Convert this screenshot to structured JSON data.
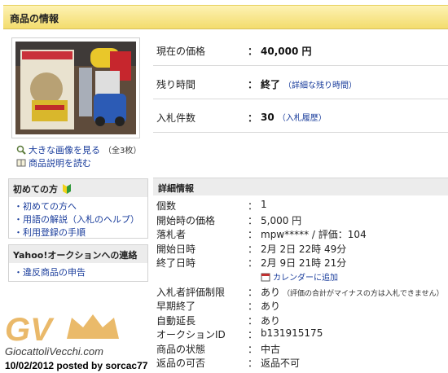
{
  "header": {
    "title": "商品の情報"
  },
  "image_links": {
    "enlarge_label": "大きな画像を見る",
    "count_label": "（全3枚）",
    "description_label": "商品説明を読む"
  },
  "first_timers": {
    "title": "初めての方",
    "items": [
      "初めての方へ",
      "用語の解説（入札のヘルプ）",
      "利用登録の手順"
    ]
  },
  "contact": {
    "title": "Yahoo!オークションへの連絡",
    "items": [
      "違反商品の申告"
    ]
  },
  "summary": {
    "colon": "：",
    "current_price_label": "現在の価格",
    "current_price_value": "40,000 円",
    "time_left_label": "残り時間",
    "time_left_value": "終了",
    "time_left_link": "（詳細な残り時間）",
    "bids_label": "入札件数",
    "bids_value": "30",
    "bids_link": "（入札履歴）"
  },
  "details": {
    "title": "詳細情報",
    "rows": [
      {
        "key": "個数",
        "value": "1"
      },
      {
        "key": "開始時の価格",
        "value": "5,000 円"
      },
      {
        "key": "落札者",
        "value": "mpw***** / 評価：104"
      },
      {
        "key": "開始日時",
        "value": "2月 2日 22時 49分"
      },
      {
        "key": "終了日時",
        "value": "2月 9日 21時 21分"
      }
    ],
    "calendar_link": "カレンダーに追加",
    "rows2": [
      {
        "key": "入札者評価制限",
        "value": "あり",
        "note": "（評価の合計がマイナスの方は入札できません）"
      },
      {
        "key": "早期終了",
        "value": "あり"
      },
      {
        "key": "自動延長",
        "value": "あり"
      },
      {
        "key": "オークションID",
        "value": "b131915175"
      },
      {
        "key": "商品の状態",
        "value": "中古"
      },
      {
        "key": "返品の可否",
        "value": "返品不可"
      }
    ]
  },
  "watermark": {
    "logo": "GV",
    "site": "GiocattoliVecchi.com",
    "caption": "10/02/2012 posted by sorcac77"
  },
  "colors": {
    "link": "#1a3d9c",
    "header_bg": "#f5df78",
    "watermark": "#e8b25a"
  }
}
